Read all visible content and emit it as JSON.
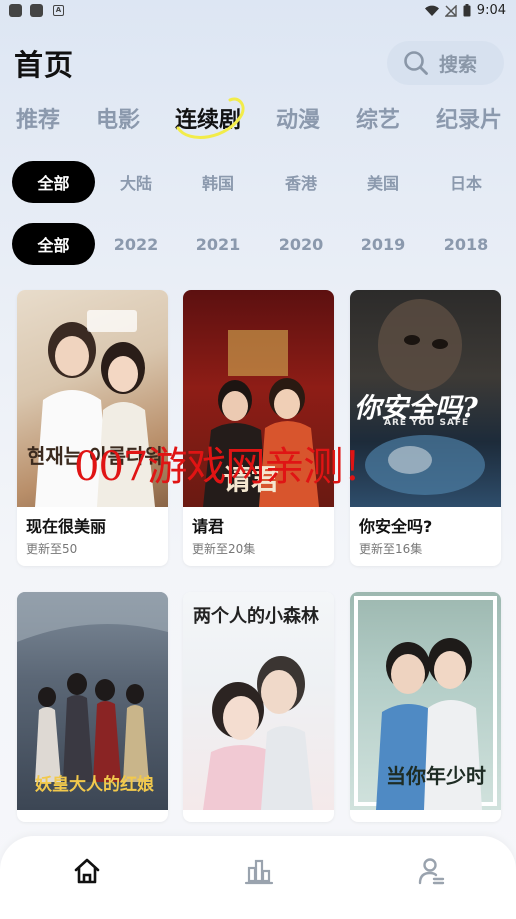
{
  "status_bar": {
    "time": "9:04"
  },
  "header": {
    "title": "首页",
    "search_label": "搜索"
  },
  "categories": [
    {
      "label": "推荐"
    },
    {
      "label": "电影"
    },
    {
      "label": "连续剧"
    },
    {
      "label": "动漫"
    },
    {
      "label": "综艺"
    },
    {
      "label": "纪录片"
    }
  ],
  "regions": [
    {
      "label": "全部"
    },
    {
      "label": "大陆"
    },
    {
      "label": "韩国"
    },
    {
      "label": "香港"
    },
    {
      "label": "美国"
    },
    {
      "label": "日本"
    }
  ],
  "years": [
    {
      "label": "全部"
    },
    {
      "label": "2022"
    },
    {
      "label": "2021"
    },
    {
      "label": "2020"
    },
    {
      "label": "2019"
    },
    {
      "label": "2018"
    }
  ],
  "shows": [
    {
      "title": "现在很美丽",
      "update": "更新至50",
      "poster_text": "현재는 아름다워"
    },
    {
      "title": "请君",
      "update": "更新至20集",
      "poster_text": "请君"
    },
    {
      "title": "你安全吗?",
      "update": "更新至16集",
      "poster_text": "你安全吗?",
      "poster_sub": "ARE YOU SAFE"
    },
    {
      "poster_text": "妖皇大人的红娘"
    },
    {
      "poster_text": "两个人的小森林"
    },
    {
      "poster_text": "当你年少时"
    }
  ],
  "watermark": "007游戏网亲测！",
  "colors": {
    "accent_active": "#000000",
    "inactive_text": "#8b99ad",
    "watermark": "#e01414"
  }
}
